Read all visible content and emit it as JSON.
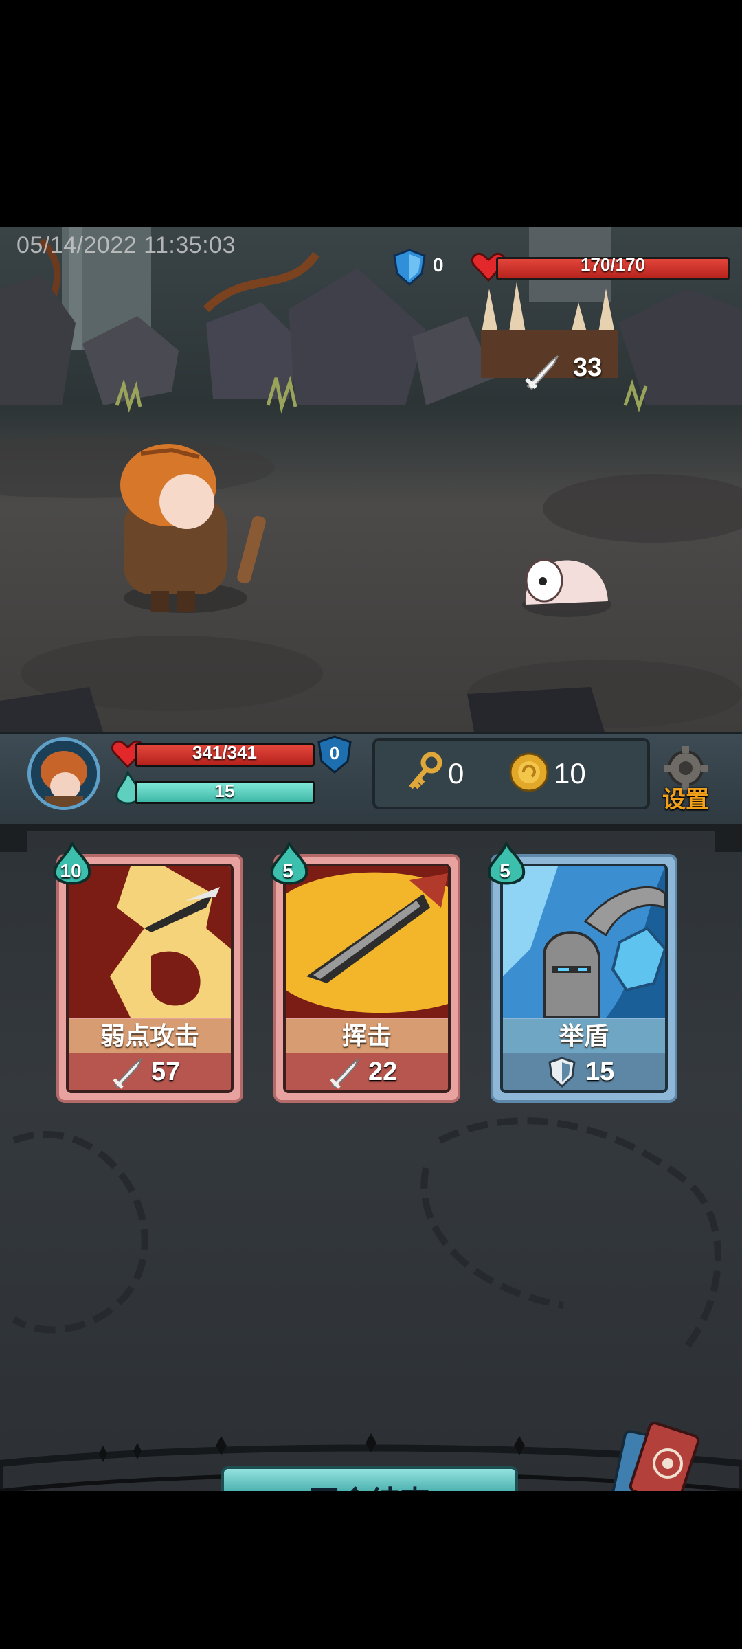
{
  "overlay": {
    "timestamp": "05/14/2022 11:35:03"
  },
  "enemy": {
    "shield_icon": "shield-icon",
    "shield": "0",
    "hp_text": "170/170",
    "hp_fraction": 1.0,
    "intent_icon": "attack-sword-icon",
    "intent_value": "33"
  },
  "player": {
    "hp_text": "341/341",
    "hp_fraction": 1.0,
    "shield": "0",
    "energy_text": "15",
    "energy_fraction": 1.0
  },
  "resources": {
    "keys": "0",
    "coins": "10"
  },
  "settings": {
    "label": "设置",
    "icon": "gear-icon"
  },
  "cards": [
    {
      "cost": "10",
      "name": "弱点攻击",
      "stat": "57",
      "stat_icon": "sword-icon",
      "color": "#b7564f"
    },
    {
      "cost": "5",
      "name": "挥击",
      "stat": "22",
      "stat_icon": "sword-icon",
      "color": "#b7564f"
    },
    {
      "cost": "5",
      "name": "举盾",
      "stat": "15",
      "stat_icon": "shield-icon",
      "color": "#5e87a5"
    }
  ],
  "end_turn": {
    "label": "回合结束"
  },
  "colors": {
    "hp": "#d3342c",
    "energy": "#5fd0c0",
    "accent": "#f2a019"
  }
}
